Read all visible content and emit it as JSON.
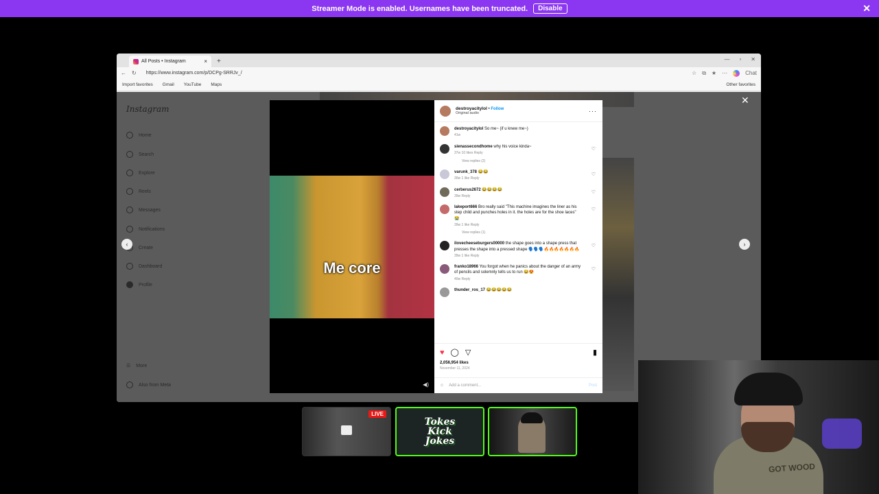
{
  "banner": {
    "text": "Streamer Mode is enabled. Usernames have been truncated.",
    "button": "Disable",
    "close": "✕"
  },
  "browser": {
    "tab_title": "All Posts • Instagram",
    "url": "https://www.instagram.com/p/DCPg-SRRJv_/",
    "favorites": [
      "Import favorites",
      "Gmail",
      "YouTube",
      "Maps"
    ],
    "other_favorites": "Other favorites",
    "copilot": "Chat"
  },
  "instagram": {
    "logo": "Instagram",
    "nav": [
      "Home",
      "Search",
      "Explore",
      "Reels",
      "Messages",
      "Notifications",
      "Create",
      "Dashboard",
      "Profile"
    ],
    "more": "More",
    "also_from_meta": "Also from Meta"
  },
  "post": {
    "username": "destroyacitylol",
    "follow": "Follow",
    "audio": "Original audio",
    "caption_overlay": "Me core",
    "comments": [
      {
        "user": "destroyacitylol",
        "text": "So me~ (if u knew me~)",
        "meta": "41w"
      },
      {
        "user": "sienassecondhome",
        "text": "why his voice kinda~",
        "meta": "37w   10 likes   Reply"
      },
      {
        "user": "varunk_378",
        "text": "😂😂",
        "meta": "30w   1 like   Reply"
      },
      {
        "user": "cerberus2672",
        "text": "😂😂😂😂",
        "meta": "39w   Reply"
      },
      {
        "user": "lakeport666",
        "text": "Bro really said \"This machine imagines the liner as his step child and punches holes in it. the holes are for the shoe laces\" 😭",
        "meta": "39w   1 like   Reply"
      },
      {
        "user": "ilovecheeseburgers00000",
        "text": "the shape goes into a shape press that presses the shape into a pressed shape 🗣️🗣️🗣️🔥🔥🔥🔥🔥🔥🔥",
        "meta": "39w   1 like   Reply"
      },
      {
        "user": "franko18966",
        "text": "You forgot when he panics about the danger of an army of pencils and solemnly tells us to run 😂😍",
        "meta": "40w   Reply"
      },
      {
        "user": "thunder_ros_17",
        "text": "😂😂😂😂😂",
        "meta": ""
      }
    ],
    "view_replies_1": "View replies (2)",
    "view_replies_2": "View replies (1)",
    "likes": "2,056,954 likes",
    "date": "November 11, 2024",
    "add_comment": "Add a comment...",
    "post_button": "Post"
  },
  "scenes": {
    "live_badge": "LIVE",
    "kick_logo_line1": "Tokes",
    "kick_logo_line2": "Kick",
    "kick_logo_line3": "Jokes"
  },
  "webcam": {
    "shirt_text": "GOT WOOD"
  }
}
